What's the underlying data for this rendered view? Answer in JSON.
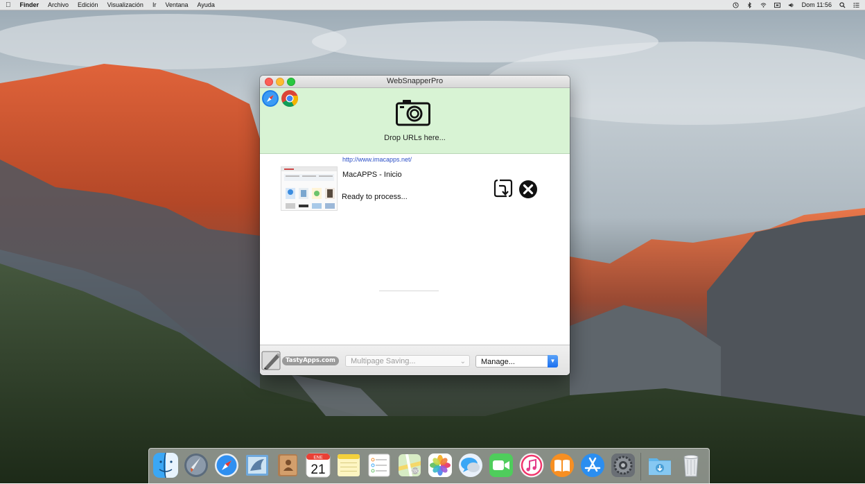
{
  "menubar": {
    "app_name": "Finder",
    "menus": [
      "Archivo",
      "Edición",
      "Visualización",
      "Ir",
      "Ventana",
      "Ayuda"
    ],
    "clock": "Dom 11:56",
    "status_icons": [
      "time-machine-icon",
      "bluetooth-icon",
      "wifi-icon",
      "keyboard-input-icon",
      "volume-icon",
      "spotlight-icon",
      "notification-center-icon"
    ]
  },
  "window": {
    "title": "WebSnapperPro",
    "drop_label": "Drop URLs here...",
    "item": {
      "url": "http://www.imacapps.net/",
      "page_title": "MacAPPS - Inicio",
      "status": "Ready to process..."
    },
    "footer": {
      "brand": "TastyApps.com",
      "saving_select": "Multipage Saving...",
      "manage_select": "Manage..."
    }
  },
  "dock": {
    "apps": [
      "Finder",
      "Launchpad",
      "Safari",
      "Mail",
      "Contactos",
      "Calendario",
      "Notas",
      "Recordatorios",
      "Mapas",
      "Fotos",
      "Mensajes",
      "FaceTime",
      "iTunes",
      "iBooks",
      "App Store",
      "Preferencias del Sistema",
      "Descargas",
      "Papelera"
    ],
    "calendar_month": "ENE",
    "calendar_day": "21"
  },
  "colors": {
    "dropzone_bg": "#d8f3d4",
    "url_link": "#2b4fc7",
    "accent_blue": "#1a6ff0"
  }
}
